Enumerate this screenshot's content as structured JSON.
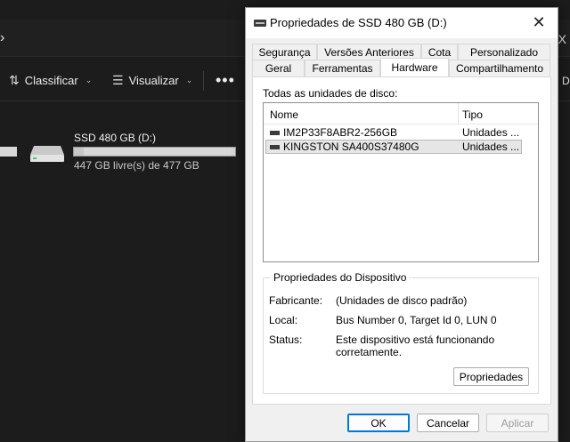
{
  "explorer": {
    "toolbar": {
      "sort_label": "Classificar",
      "view_label": "Visualizar",
      "more_label": "•••",
      "cut_label": "D"
    },
    "drive": {
      "name": "SSD 480 GB (D:)",
      "free_space": "447 GB livre(s) de 477 GB",
      "used_fraction": 0.06
    },
    "right_glyph": "X"
  },
  "dialog": {
    "title": "Propriedades de SSD 480 GB (D:)",
    "close_glyph": "✕",
    "tabs_row1": [
      "Segurança",
      "Versões Anteriores",
      "Cota",
      "Personalizado"
    ],
    "tabs_row2": [
      "Geral",
      "Ferramentas",
      "Hardware",
      "Compartilhamento"
    ],
    "active_tab": "Hardware",
    "disks_label": "Todas as unidades de disco:",
    "columns": [
      "Nome",
      "Tipo"
    ],
    "disks": [
      {
        "name": "IM2P33F8ABR2-256GB",
        "type": "Unidades ..."
      },
      {
        "name": "KINGSTON SA400S37480G",
        "type": "Unidades ..."
      }
    ],
    "selected_disk_index": 1,
    "device_props": {
      "title": "Propriedades do Dispositivo",
      "manufacturer_label": "Fabricante:",
      "manufacturer_value": "(Unidades de disco padrão)",
      "location_label": "Local:",
      "location_value": "Bus Number 0, Target Id 0, LUN 0",
      "status_label": "Status:",
      "status_value_line1": "Este dispositivo está funcionando",
      "status_value_line2": "corretamente.",
      "properties_button": "Propriedades"
    },
    "buttons": {
      "ok": "OK",
      "cancel": "Cancelar",
      "apply": "Aplicar"
    }
  },
  "colors": {
    "explorer_bg": "#1c1c1c",
    "dialog_bg": "#f0f0f0",
    "accent": "#0078d7"
  }
}
